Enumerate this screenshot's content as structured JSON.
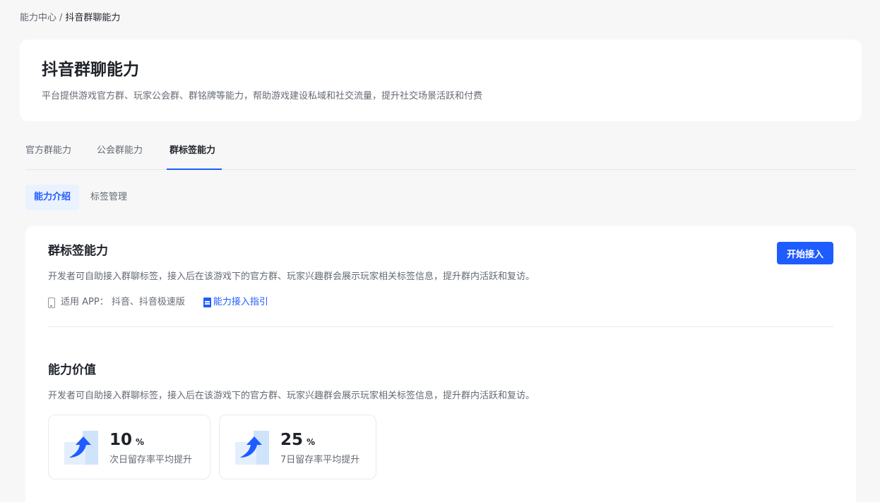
{
  "breadcrumb": {
    "parent": "能力中心",
    "separator": "/",
    "current": "抖音群聊能力"
  },
  "header": {
    "title": "抖音群聊能力",
    "description": "平台提供游戏官方群、玩家公会群、群铭牌等能力，帮助游戏建设私域和社交流量，提升社交场景活跃和付费"
  },
  "tabs": [
    {
      "label": "官方群能力",
      "active": false
    },
    {
      "label": "公会群能力",
      "active": false
    },
    {
      "label": "群标签能力",
      "active": true
    }
  ],
  "subtabs": [
    {
      "label": "能力介绍",
      "active": true
    },
    {
      "label": "标签管理",
      "active": false
    }
  ],
  "intro": {
    "title": "群标签能力",
    "description": "开发者可自助接入群聊标签，接入后在该游戏下的官方群、玩家兴趣群会展示玩家相关标签信息，提升群内活跃和复访。",
    "start_button": "开始接入",
    "apps_label": "适用 APP： 抖音、抖音极速版",
    "guide_link": "能力接入指引"
  },
  "value": {
    "title": "能力价值",
    "description": "开发者可自助接入群聊标签，接入后在该游戏下的官方群、玩家兴趣群会展示玩家相关标签信息，提升群内活跃和复访。",
    "stats": [
      {
        "value": "10",
        "unit": "%",
        "label": "次日留存率平均提升"
      },
      {
        "value": "25",
        "unit": "%",
        "label": "7日留存率平均提升"
      }
    ]
  },
  "colors": {
    "accent": "#1e5cff",
    "background": "#f7f7f8",
    "icon_light": "#cfe3fb"
  },
  "icons": [
    "phone-icon",
    "document-icon",
    "growth-arrow-icon"
  ]
}
